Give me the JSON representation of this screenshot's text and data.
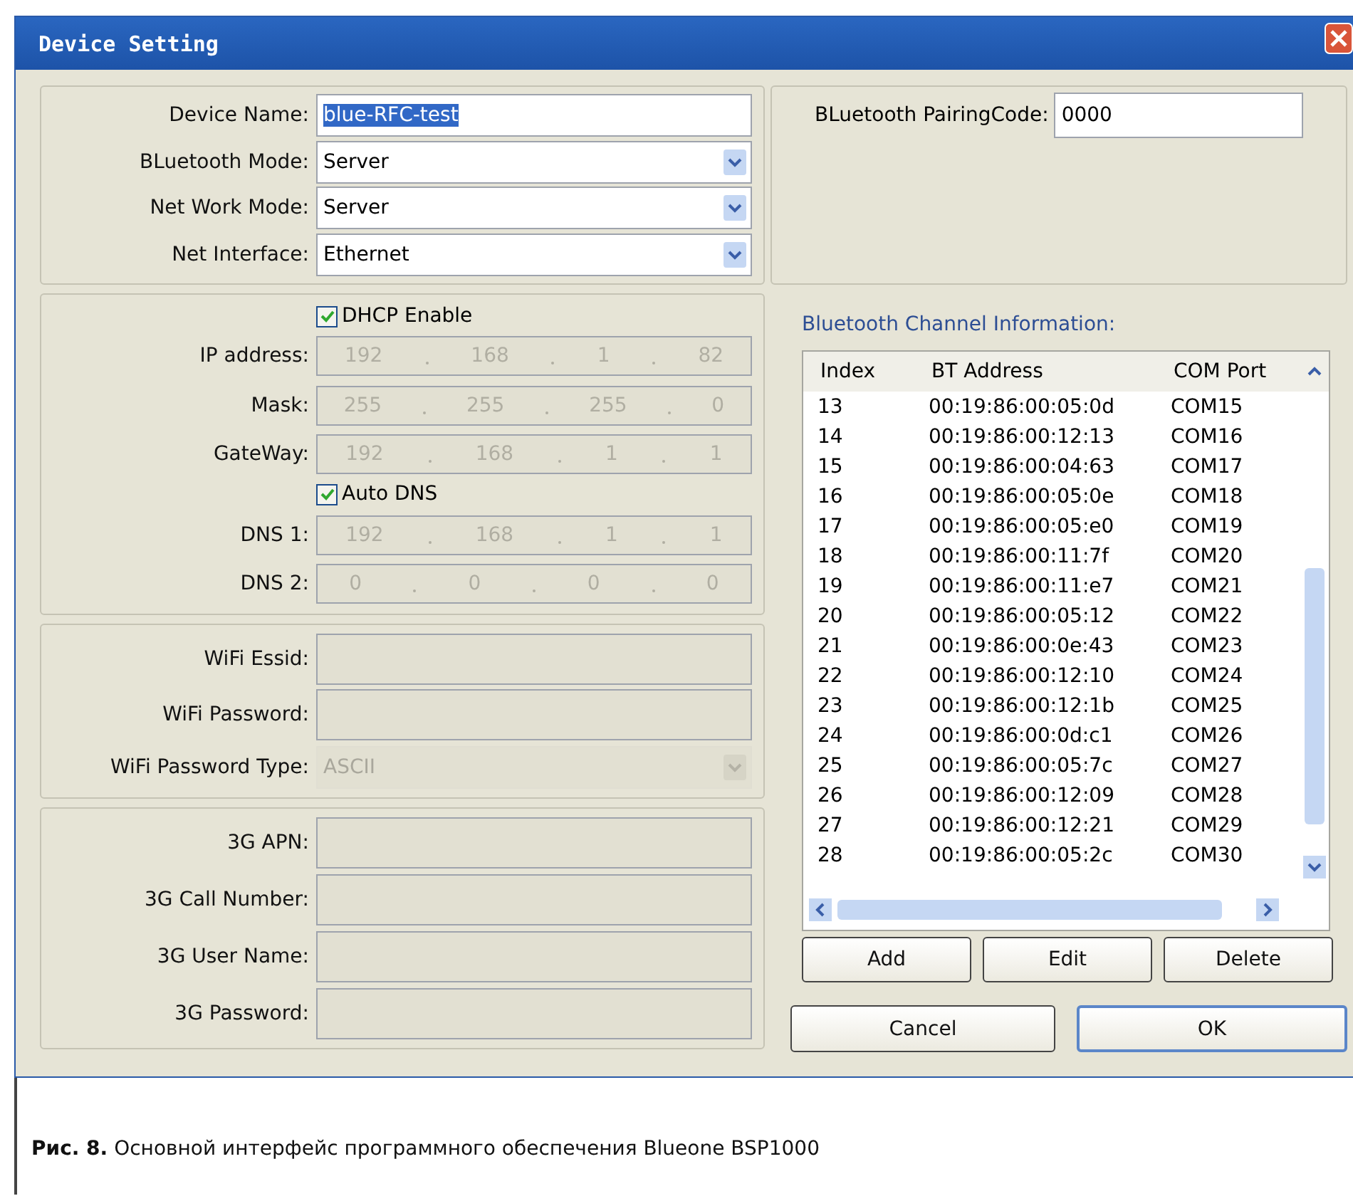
{
  "window": {
    "title": "Device Setting"
  },
  "device": {
    "items": [
      {
        "kind": "text",
        "label": "Device Name:",
        "value": "blue-RFC-test",
        "text_selected": true
      },
      {
        "kind": "dropdown",
        "label": "BLuetooth Mode:",
        "value": "Server",
        "disabled": false
      },
      {
        "kind": "dropdown",
        "label": "Net Work Mode:",
        "value": "Server",
        "disabled": false
      },
      {
        "kind": "dropdown",
        "label": "Net Interface:",
        "value": "Ethernet",
        "disabled": false
      }
    ]
  },
  "pairing": {
    "label": "BLuetooth PairingCode:",
    "value": "0000"
  },
  "network": {
    "items": [
      {
        "kind": "checkbox",
        "label": "DHCP Enable",
        "checked": true
      },
      {
        "kind": "ip",
        "label": "IP address:",
        "octets": [
          "192",
          "168",
          "1",
          "82"
        ],
        "disabled": true
      },
      {
        "kind": "ip",
        "label": "Mask:",
        "octets": [
          "255",
          "255",
          "255",
          "0"
        ],
        "disabled": true
      },
      {
        "kind": "ip",
        "label": "GateWay:",
        "octets": [
          "192",
          "168",
          "1",
          "1"
        ],
        "disabled": true
      },
      {
        "kind": "checkbox",
        "label": "Auto DNS",
        "checked": true
      },
      {
        "kind": "ip",
        "label": "DNS 1:",
        "octets": [
          "192",
          "168",
          "1",
          "1"
        ],
        "disabled": true
      },
      {
        "kind": "ip",
        "label": "DNS 2:",
        "octets": [
          "0",
          "0",
          "0",
          "0"
        ],
        "disabled": true
      }
    ]
  },
  "wifi": {
    "items": [
      {
        "kind": "text",
        "label": "WiFi Essid:",
        "disabled": true
      },
      {
        "kind": "text",
        "label": "WiFi Password:",
        "disabled": true
      },
      {
        "kind": "dropdown",
        "label": "WiFi Password Type:",
        "value": "ASCII",
        "disabled": true
      }
    ]
  },
  "cellular": {
    "items": [
      {
        "kind": "text",
        "label": "3G APN:",
        "disabled": true
      },
      {
        "kind": "text",
        "label": "3G Call Number:",
        "disabled": true
      },
      {
        "kind": "text",
        "label": "3G User Name:",
        "disabled": true
      },
      {
        "kind": "text",
        "label": "3G Password:",
        "disabled": true
      }
    ]
  },
  "channels": {
    "title": "Bluetooth Channel Information:",
    "columns": [
      "Index",
      "BT Address",
      "COM Port"
    ],
    "rows": [
      [
        "13",
        "00:19:86:00:05:0d",
        "COM15"
      ],
      [
        "14",
        "00:19:86:00:12:13",
        "COM16"
      ],
      [
        "15",
        "00:19:86:00:04:63",
        "COM17"
      ],
      [
        "16",
        "00:19:86:00:05:0e",
        "COM18"
      ],
      [
        "17",
        "00:19:86:00:05:e0",
        "COM19"
      ],
      [
        "18",
        "00:19:86:00:11:7f",
        "COM20"
      ],
      [
        "19",
        "00:19:86:00:11:e7",
        "COM21"
      ],
      [
        "20",
        "00:19:86:00:05:12",
        "COM22"
      ],
      [
        "21",
        "00:19:86:00:0e:43",
        "COM23"
      ],
      [
        "22",
        "00:19:86:00:12:10",
        "COM24"
      ],
      [
        "23",
        "00:19:86:00:12:1b",
        "COM25"
      ],
      [
        "24",
        "00:19:86:00:0d:c1",
        "COM26"
      ],
      [
        "25",
        "00:19:86:00:05:7c",
        "COM27"
      ],
      [
        "26",
        "00:19:86:00:12:09",
        "COM28"
      ],
      [
        "27",
        "00:19:86:00:12:21",
        "COM29"
      ],
      [
        "28",
        "00:19:86:00:05:2c",
        "COM30"
      ]
    ]
  },
  "list_buttons": [
    "Add",
    "Edit",
    "Delete"
  ],
  "dialog_buttons": [
    {
      "label": "Cancel",
      "default": false
    },
    {
      "label": "OK",
      "default": true
    }
  ],
  "caption": "**Рис. 8.** Основной интерфейс программного обеспечения Blueone BSP1000"
}
